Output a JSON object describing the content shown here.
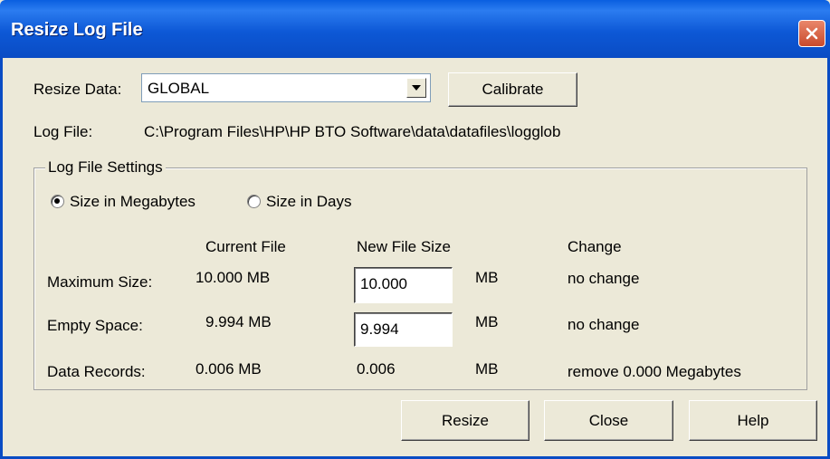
{
  "window": {
    "title": "Resize Log File"
  },
  "resize_data": {
    "label": "Resize Data:",
    "selected": "GLOBAL",
    "calibrate_label": "Calibrate"
  },
  "log_file": {
    "label": "Log File:",
    "path": "C:\\Program Files\\HP\\HP BTO Software\\data\\datafiles\\logglob"
  },
  "settings": {
    "group_label": "Log File Settings",
    "radio_megabytes": "Size in Megabytes",
    "radio_days": "Size in Days",
    "selected_mode": "megabytes",
    "headers": {
      "current": "Current File",
      "new": "New File Size",
      "change": "Change"
    },
    "rows": [
      {
        "label": "Maximum Size:",
        "current": "10.000  MB",
        "new": "10.000",
        "unit": "MB",
        "change": "no change"
      },
      {
        "label": "Empty Space:",
        "current": "9.994  MB",
        "new": "9.994",
        "unit": "MB",
        "change": "no change"
      },
      {
        "label": "Data Records:",
        "current": "0.006  MB",
        "new": "0.006",
        "unit": "MB",
        "change": "remove 0.000 Megabytes"
      }
    ]
  },
  "buttons": {
    "resize": "Resize",
    "close": "Close",
    "help": "Help"
  }
}
